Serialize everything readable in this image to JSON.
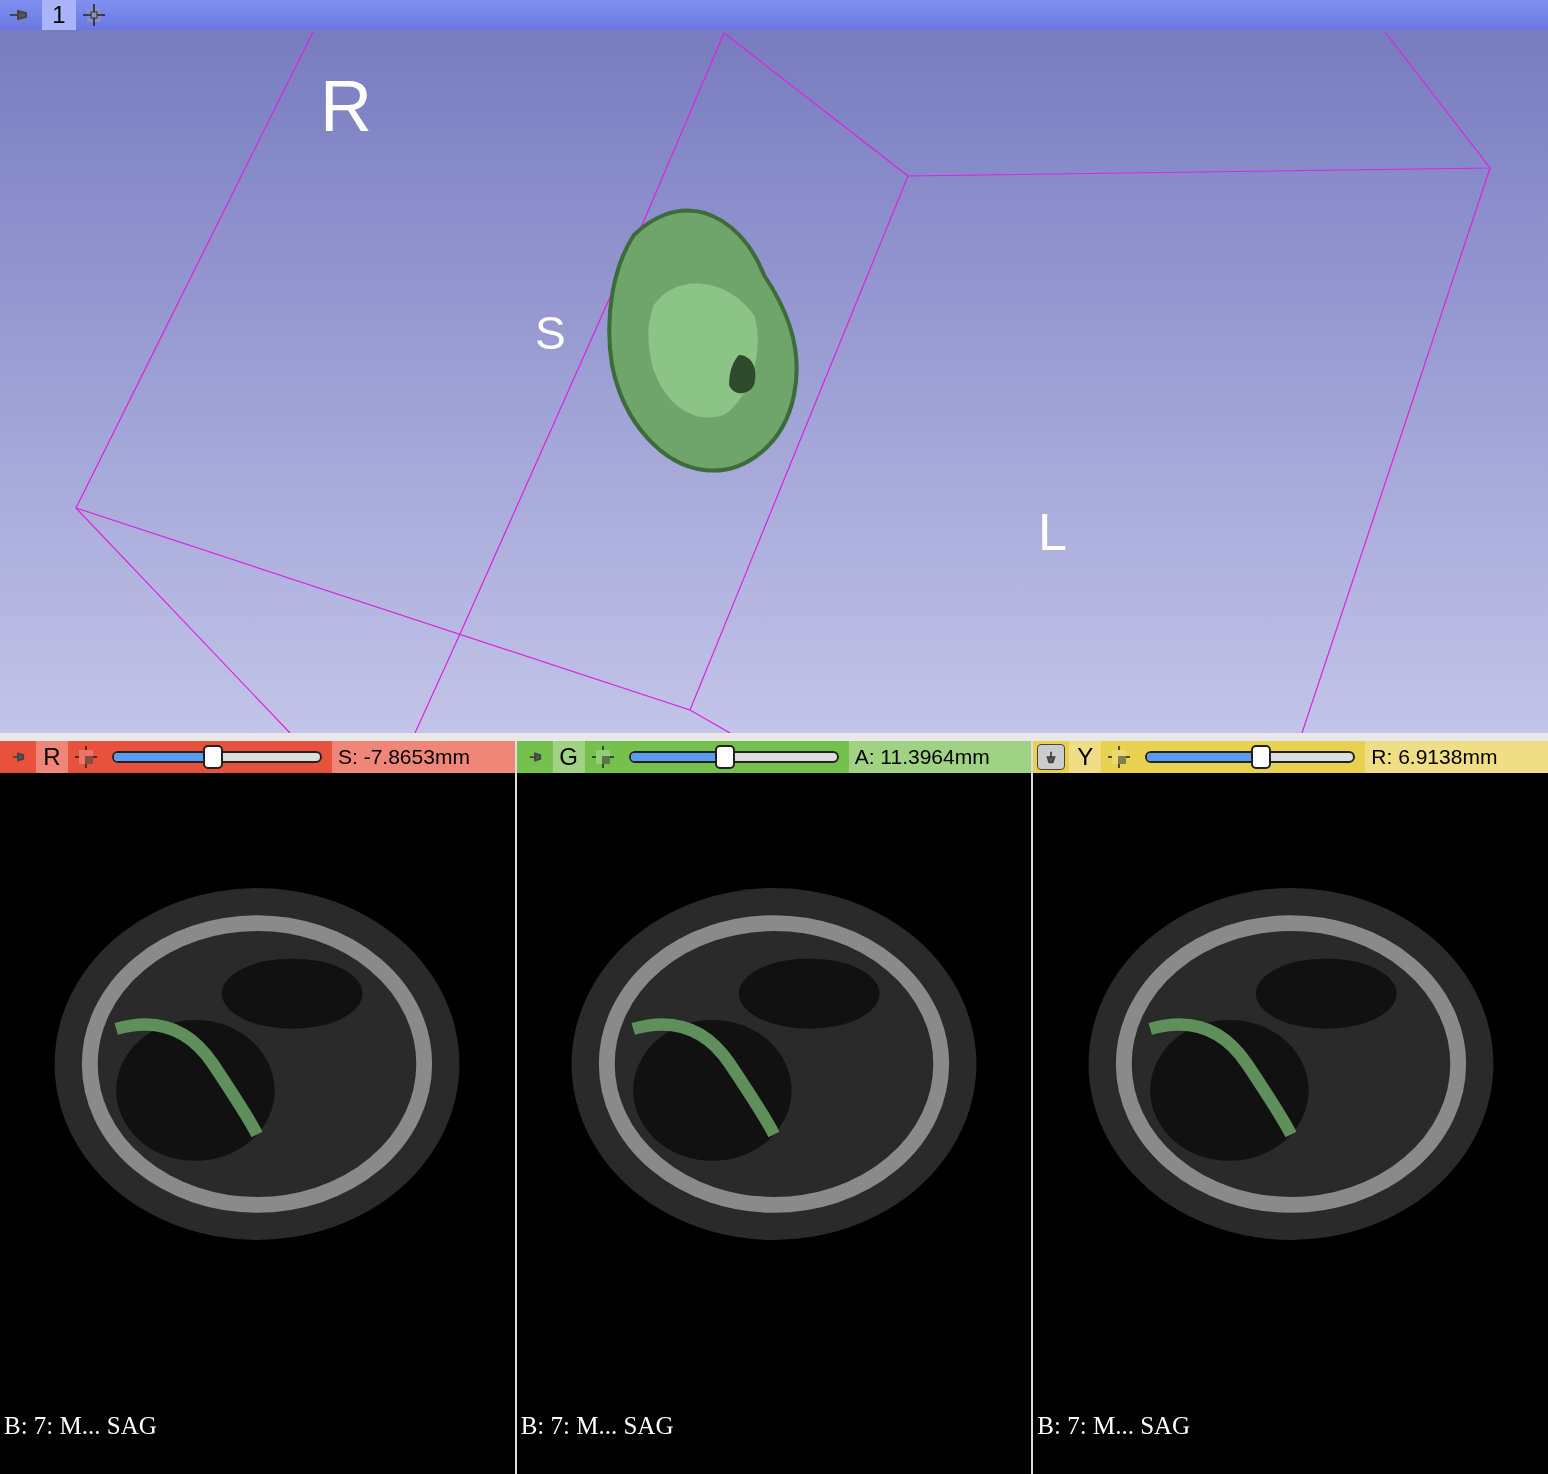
{
  "view3d": {
    "title": "1",
    "labels": [
      "R",
      "S",
      "L"
    ]
  },
  "slice_views": [
    {
      "letter": "R",
      "color": "#e8523c",
      "pinned": false,
      "level": 0.48,
      "offset": "S: -7.8653mm",
      "annotation": "B: 7: M... SAG"
    },
    {
      "letter": "G",
      "color": "#76c04e",
      "pinned": false,
      "level": 0.46,
      "offset": "A: 11.3964mm",
      "annotation": "B: 7: M... SAG"
    },
    {
      "letter": "Y",
      "color": "#e8d050",
      "pinned": true,
      "level": 0.55,
      "offset": "R: 6.9138mm",
      "annotation": "B: 7: M... SAG"
    }
  ]
}
